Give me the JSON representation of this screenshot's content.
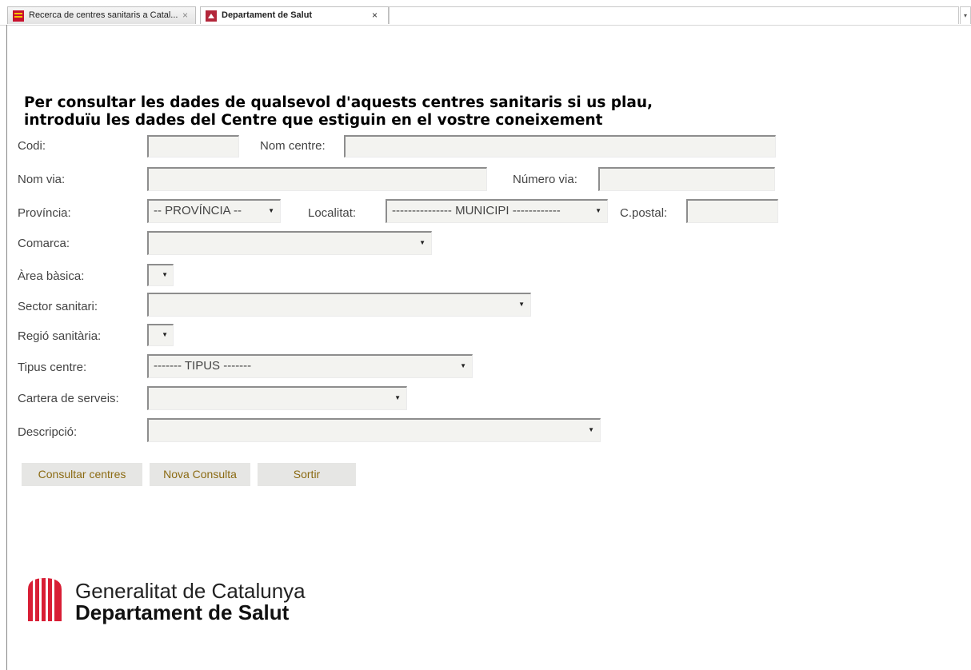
{
  "browser": {
    "tabs": [
      {
        "label": "Recerca de centres sanitaris a Catal...",
        "close": "×",
        "active": false
      },
      {
        "label": "Departament de Salut",
        "close": "×",
        "active": true
      }
    ],
    "tab_list_arrow": "▾"
  },
  "page": {
    "heading_line1": "Per consultar les dades de qualsevol d'aquests centres sanitaris si us plau,",
    "heading_line2": "introduïu les dades del Centre que estiguin en el vostre coneixement"
  },
  "form": {
    "codi_label": "Codi:",
    "codi_value": "",
    "nom_centre_label": "Nom centre:",
    "nom_centre_value": "",
    "nom_via_label": "Nom via:",
    "nom_via_value": "",
    "numero_via_label": "Número via:",
    "numero_via_value": "",
    "provincia_label": "Província:",
    "provincia_selected": "-- PROVÍNCIA --",
    "localitat_label": "Localitat:",
    "localitat_selected": "--------------- MUNICIPI ------------",
    "cpostal_label": "C.postal:",
    "cpostal_value": "",
    "comarca_label": "Comarca:",
    "comarca_selected": "",
    "area_basica_label": "Àrea bàsica:",
    "area_basica_selected": "",
    "sector_sanitari_label": "Sector sanitari:",
    "sector_sanitari_selected": "",
    "regio_sanitaria_label": "Regió sanitària:",
    "regio_sanitaria_selected": "",
    "tipus_centre_label": "Tipus centre:",
    "tipus_centre_selected": "------- TIPUS -------",
    "cartera_serveis_label": "Cartera de serveis:",
    "cartera_serveis_selected": "",
    "descripcio_label": "Descripció:",
    "descripcio_selected": "",
    "dropdown_arrow": "▼"
  },
  "buttons": {
    "consultar": "Consultar centres",
    "nova": "Nova Consulta",
    "sortir": "Sortir"
  },
  "logo": {
    "line1": "Generalitat de Catalunya",
    "line2": "Departament de Salut",
    "icon": "generalitat-logo-icon"
  },
  "colors": {
    "button_text": "#8b6a12",
    "button_bg": "#e6e6e4",
    "logo_red": "#c8102e"
  }
}
